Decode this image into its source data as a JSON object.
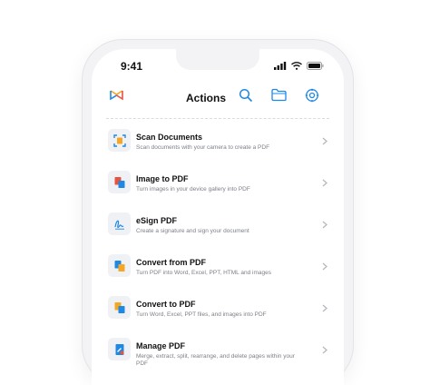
{
  "status_bar": {
    "time": "9:41"
  },
  "header": {
    "title": "Actions"
  },
  "actions": [
    {
      "title": "Scan Documents",
      "description": "Scan documents with your camera to create a PDF",
      "icon": "scan-icon"
    },
    {
      "title": "Image to PDF",
      "description": "Turn images in your device gallery into PDF",
      "icon": "image-to-pdf-icon"
    },
    {
      "title": "eSign PDF",
      "description": "Create a signature and sign your document",
      "icon": "signature-icon"
    },
    {
      "title": "Convert from PDF",
      "description": "Turn PDF into Word, Excel, PPT, HTML and images",
      "icon": "convert-from-pdf-icon"
    },
    {
      "title": "Convert to PDF",
      "description": "Turn Word, Excel, PPT files, and images into PDF",
      "icon": "convert-to-pdf-icon"
    },
    {
      "title": "Manage PDF",
      "description": "Merge, extract, split, rearrange, and delete pages within your PDF",
      "icon": "manage-pdf-icon"
    }
  ],
  "colors": {
    "accent": "#1e88e5",
    "orange": "#f5a623",
    "red": "#e8533f"
  }
}
